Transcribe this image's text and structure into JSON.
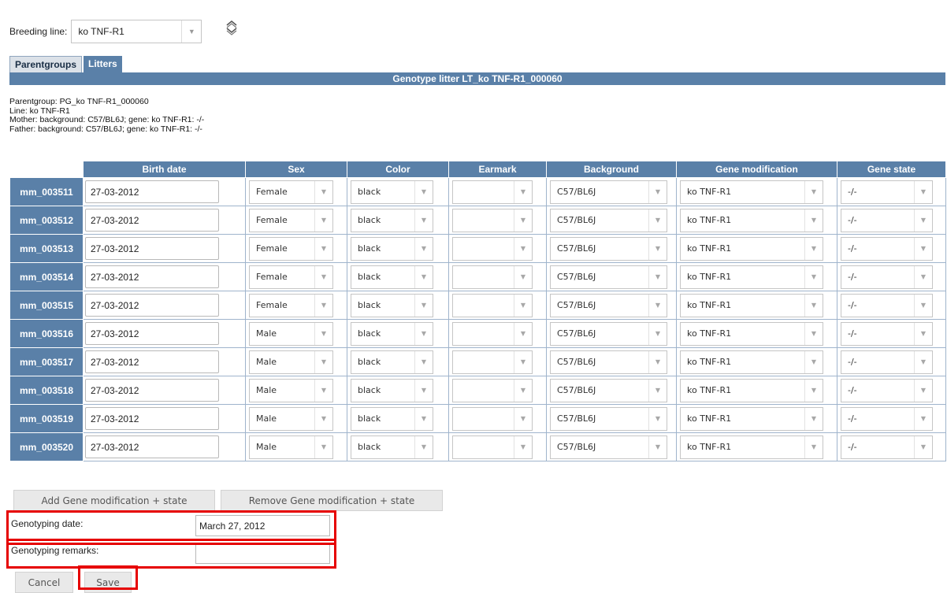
{
  "breeding_line": {
    "label": "Breeding line:",
    "value": "ko TNF-R1"
  },
  "tabs": [
    {
      "label": "Parentgroups"
    },
    {
      "label": "Litters"
    }
  ],
  "title": "Genotype litter LT_ko TNF-R1_000060",
  "info": {
    "parentgroup": "Parentgroup: PG_ko TNF-R1_000060",
    "line": "Line: ko TNF-R1",
    "mother": "Mother: background: C57/BL6J; gene: ko TNF-R1: -/-",
    "father": "Father: background: C57/BL6J; gene: ko TNF-R1: -/-"
  },
  "columns": [
    "Birth date",
    "Sex",
    "Color",
    "Earmark",
    "Background",
    "Gene modification",
    "Gene state"
  ],
  "rows": [
    {
      "id": "mm_003511",
      "birth_date": "27-03-2012",
      "sex": "Female",
      "color": "black",
      "earmark": "",
      "background": "C57/BL6J",
      "gene_mod": "ko TNF-R1",
      "gene_state": "-/-"
    },
    {
      "id": "mm_003512",
      "birth_date": "27-03-2012",
      "sex": "Female",
      "color": "black",
      "earmark": "",
      "background": "C57/BL6J",
      "gene_mod": "ko TNF-R1",
      "gene_state": "-/-"
    },
    {
      "id": "mm_003513",
      "birth_date": "27-03-2012",
      "sex": "Female",
      "color": "black",
      "earmark": "",
      "background": "C57/BL6J",
      "gene_mod": "ko TNF-R1",
      "gene_state": "-/-"
    },
    {
      "id": "mm_003514",
      "birth_date": "27-03-2012",
      "sex": "Female",
      "color": "black",
      "earmark": "",
      "background": "C57/BL6J",
      "gene_mod": "ko TNF-R1",
      "gene_state": "-/-"
    },
    {
      "id": "mm_003515",
      "birth_date": "27-03-2012",
      "sex": "Female",
      "color": "black",
      "earmark": "",
      "background": "C57/BL6J",
      "gene_mod": "ko TNF-R1",
      "gene_state": "-/-"
    },
    {
      "id": "mm_003516",
      "birth_date": "27-03-2012",
      "sex": "Male",
      "color": "black",
      "earmark": "",
      "background": "C57/BL6J",
      "gene_mod": "ko TNF-R1",
      "gene_state": "-/-"
    },
    {
      "id": "mm_003517",
      "birth_date": "27-03-2012",
      "sex": "Male",
      "color": "black",
      "earmark": "",
      "background": "C57/BL6J",
      "gene_mod": "ko TNF-R1",
      "gene_state": "-/-"
    },
    {
      "id": "mm_003518",
      "birth_date": "27-03-2012",
      "sex": "Male",
      "color": "black",
      "earmark": "",
      "background": "C57/BL6J",
      "gene_mod": "ko TNF-R1",
      "gene_state": "-/-"
    },
    {
      "id": "mm_003519",
      "birth_date": "27-03-2012",
      "sex": "Male",
      "color": "black",
      "earmark": "",
      "background": "C57/BL6J",
      "gene_mod": "ko TNF-R1",
      "gene_state": "-/-"
    },
    {
      "id": "mm_003520",
      "birth_date": "27-03-2012",
      "sex": "Male",
      "color": "black",
      "earmark": "",
      "background": "C57/BL6J",
      "gene_mod": "ko TNF-R1",
      "gene_state": "-/-"
    }
  ],
  "buttons": {
    "add_gene": "Add Gene modification + state",
    "remove_gene": "Remove Gene modification + state",
    "cancel": "Cancel",
    "save": "Save"
  },
  "genotyping": {
    "date_label": "Genotyping date:",
    "date_value": "March 27, 2012",
    "remarks_label": "Genotyping remarks:",
    "remarks_value": ""
  },
  "icons": {
    "dropdown": "chevron-down-icon",
    "refresh": "refresh-icon"
  },
  "colors": {
    "header_blue": "#5a80a8",
    "highlight": "#e60000"
  }
}
